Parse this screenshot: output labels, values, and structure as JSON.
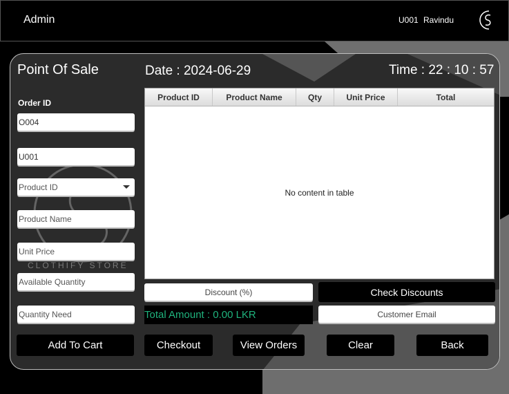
{
  "header": {
    "role": "Admin",
    "user_id": "U001",
    "user_name": "Ravindu"
  },
  "pos": {
    "title": "Point Of Sale",
    "date": "Date : 2024-06-29",
    "time": "Time : 22 : 10 : 57"
  },
  "form": {
    "order_id_label": "Order ID",
    "order_id_value": "O004",
    "user_id_value": "U001",
    "product_id_placeholder": "Product ID",
    "product_name_placeholder": "Product Name",
    "unit_price_placeholder": "Unit Price",
    "available_qty_placeholder": "Available Quantity",
    "qty_need_placeholder": "Quantity Need"
  },
  "watermark": {
    "text": "CLOTHIFY STORE"
  },
  "table": {
    "columns": [
      "Product ID",
      "Product Name",
      "Qty",
      "Unit Price",
      "Total"
    ],
    "empty_message": "No content in table"
  },
  "discount_placeholder": "Discount (%)",
  "customer_email_placeholder": "Customer Email",
  "total_amount": "Total Amount : 0.00 LKR",
  "buttons": {
    "check_discounts": "Check Discounts",
    "add_to_cart": "Add To Cart",
    "checkout": "Checkout",
    "view_orders": "View Orders",
    "clear": "Clear",
    "back": "Back"
  },
  "colors": {
    "accent_text": "#1fb37d",
    "panel": "#2b2b2b",
    "background": "#000000"
  }
}
